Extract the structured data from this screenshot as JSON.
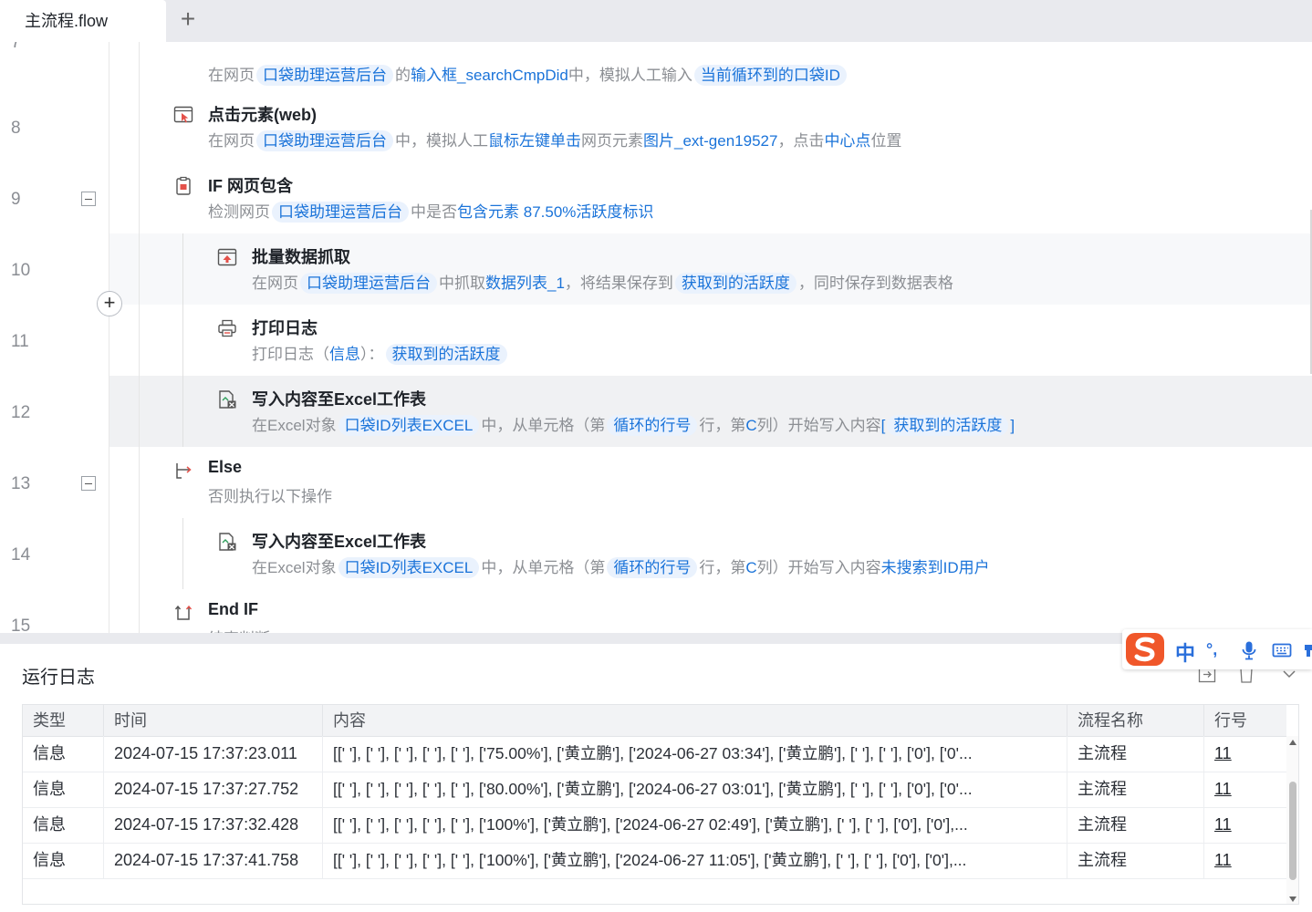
{
  "tabs": {
    "active_label": "主流程.flow",
    "add_label": "+"
  },
  "rows": [
    {
      "line": "7",
      "title": "",
      "desc": [
        {
          "t": "在网页"
        },
        {
          "t": "口袋助理运营后台",
          "k": "tag"
        },
        {
          "t": "的"
        },
        {
          "t": "输入框_searchCmpDid",
          "k": "kw"
        },
        {
          "t": "中，模拟人工输入"
        },
        {
          "t": "当前循环到的口袋ID",
          "k": "tag"
        }
      ]
    },
    {
      "line": "8",
      "title": "点击元素(web)",
      "desc": [
        {
          "t": "在网页"
        },
        {
          "t": "口袋助理运营后台",
          "k": "tag"
        },
        {
          "t": "中，模拟人工"
        },
        {
          "t": "鼠标左键单击",
          "k": "kw"
        },
        {
          "t": "网页元素"
        },
        {
          "t": "图片_ext-gen19527",
          "k": "kw"
        },
        {
          "t": "，点击"
        },
        {
          "t": "中心点",
          "k": "kw"
        },
        {
          "t": "位置"
        }
      ]
    },
    {
      "line": "9",
      "title": "IF 网页包含",
      "desc": [
        {
          "t": "检测网页"
        },
        {
          "t": "口袋助理运营后台",
          "k": "tag"
        },
        {
          "t": "中是否"
        },
        {
          "t": "包含元素",
          "k": "kw"
        },
        {
          "t": " "
        },
        {
          "t": "87.50%活跃度标识",
          "k": "kw"
        }
      ]
    },
    {
      "line": "10",
      "title": "批量数据抓取",
      "desc": [
        {
          "t": "在网页"
        },
        {
          "t": "口袋助理运营后台",
          "k": "tag"
        },
        {
          "t": "中抓取"
        },
        {
          "t": "数据列表_1",
          "k": "kw"
        },
        {
          "t": "，将结果保存到"
        },
        {
          "t": "获取到的活跃度",
          "k": "tag"
        },
        {
          "t": "，同时保存到数据表格"
        }
      ]
    },
    {
      "line": "11",
      "title": "打印日志",
      "desc": [
        {
          "t": "打印日志（"
        },
        {
          "t": "信息",
          "k": "kw"
        },
        {
          "t": "）："
        },
        {
          "t": "获取到的活跃度",
          "k": "tag"
        }
      ]
    },
    {
      "line": "12",
      "title": "写入内容至Excel工作表",
      "desc": [
        {
          "t": "在Excel对象"
        },
        {
          "t": "口袋ID列表EXCEL",
          "k": "tag"
        },
        {
          "t": "中，从单元格（第"
        },
        {
          "t": "循环的行号",
          "k": "tag"
        },
        {
          "t": "行，第"
        },
        {
          "t": "C",
          "k": "kw"
        },
        {
          "t": "列）开始写入内容"
        },
        {
          "t": "[",
          "k": "kw"
        },
        {
          "t": "获取到的活跃度",
          "k": "tag"
        },
        {
          "t": "]",
          "k": "kw"
        }
      ]
    },
    {
      "line": "13",
      "title": "Else",
      "desc": [
        {
          "t": "否则执行以下操作"
        }
      ]
    },
    {
      "line": "14",
      "title": "写入内容至Excel工作表",
      "desc": [
        {
          "t": "在Excel对象"
        },
        {
          "t": "口袋ID列表EXCEL",
          "k": "tag"
        },
        {
          "t": "中，从单元格（第"
        },
        {
          "t": "循环的行号",
          "k": "tag"
        },
        {
          "t": "行，第"
        },
        {
          "t": "C",
          "k": "kw"
        },
        {
          "t": "列）开始写入内容"
        },
        {
          "t": "未搜索到ID用户",
          "k": "kw"
        }
      ]
    },
    {
      "line": "15",
      "title": "End IF",
      "desc": [
        {
          "t": "结束判断"
        }
      ]
    }
  ],
  "log": {
    "title": "运行日志",
    "columns": [
      "类型",
      "时间",
      "内容",
      "流程名称",
      "行号"
    ],
    "rows": [
      [
        "信息",
        "2024-07-15 17:37:23.011",
        "[[' '], [' '], [' '], [' '], [' '], ['75.00%'], ['黄立鹏'], ['2024-06-27 03:34'], ['黄立鹏'], [' '], [' '], ['0'], ['0'...",
        "主流程",
        "11"
      ],
      [
        "信息",
        "2024-07-15 17:37:27.752",
        "[[' '], [' '], [' '], [' '], [' '], ['80.00%'], ['黄立鹏'], ['2024-06-27 03:01'], ['黄立鹏'], [' '], [' '], ['0'], ['0'...",
        "主流程",
        "11"
      ],
      [
        "信息",
        "2024-07-15 17:37:32.428",
        "[[' '], [' '], [' '], [' '], [' '], ['100%'], ['黄立鹏'], ['2024-06-27 02:49'], ['黄立鹏'], [' '], [' '], ['0'], ['0'],...",
        "主流程",
        "11"
      ],
      [
        "信息",
        "2024-07-15 17:37:41.758",
        "[[' '], [' '], [' '], [' '], [' '], ['100%'], ['黄立鹏'], ['2024-06-27 11:05'], ['黄立鹏'], [' '], [' '], ['0'], ['0'],...",
        "主流程",
        "11"
      ]
    ]
  },
  "ime": {
    "mode_label": "中",
    "punct_label": "°,"
  },
  "icons": {
    "click": "click-element-icon",
    "if": "if-web-contains-icon",
    "scrape": "data-scrape-icon",
    "print": "print-log-icon",
    "excel": "excel-write-icon",
    "else": "else-branch-icon",
    "endif": "end-if-icon"
  },
  "colors": {
    "link": "#1a73d9",
    "tag_bg": "#eaf2fd",
    "ime_logo": "#f0572a"
  }
}
